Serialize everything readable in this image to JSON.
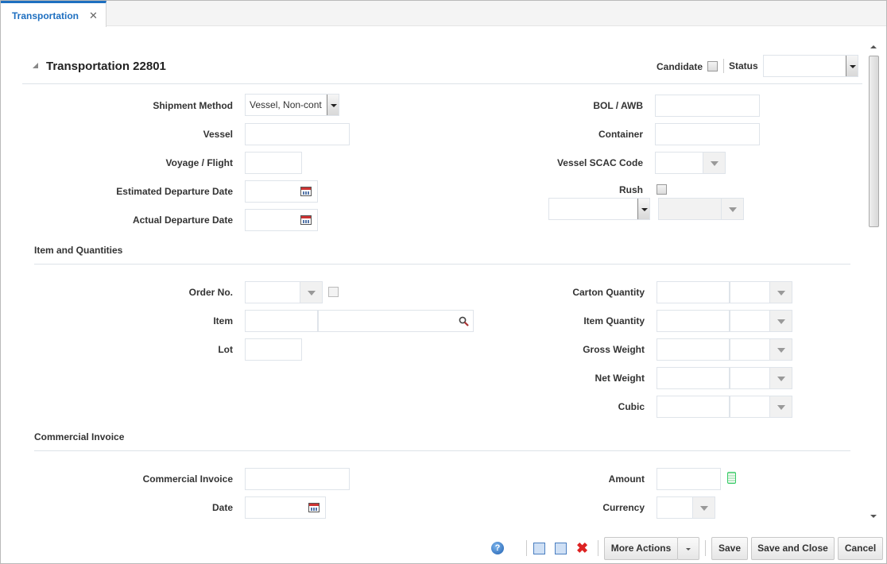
{
  "tab": {
    "label": "Transportation",
    "close": "✕"
  },
  "header": {
    "title": "Transportation 22801",
    "candidate_label": "Candidate",
    "candidate_checked": false,
    "status_label": "Status",
    "status_value": ""
  },
  "shipment": {
    "shipment_method_label": "Shipment Method",
    "shipment_method_value": "Vessel, Non-cont",
    "vessel_label": "Vessel",
    "vessel_value": "",
    "voyage_label": "Voyage / Flight",
    "voyage_value": "",
    "est_departure_label": "Estimated Departure Date",
    "est_departure_value": "",
    "act_departure_label": "Actual Departure Date",
    "act_departure_value": "",
    "bol_label": "BOL / AWB",
    "bol_value": "",
    "container_label": "Container",
    "container_value": "",
    "scac_label": "Vessel SCAC Code",
    "scac_value": "",
    "rush_label": "Rush",
    "rush_checked": false
  },
  "items": {
    "section_title": "Item and Quantities",
    "order_label": "Order No.",
    "item_label": "Item",
    "lot_label": "Lot",
    "carton_label": "Carton Quantity",
    "item_qty_label": "Item Quantity",
    "gross_label": "Gross Weight",
    "net_label": "Net Weight",
    "cubic_label": "Cubic"
  },
  "invoice": {
    "section_title": "Commercial Invoice",
    "invoice_label": "Commercial Invoice",
    "date_label": "Date",
    "amount_label": "Amount",
    "currency_label": "Currency"
  },
  "footer": {
    "more_actions": "More Actions",
    "save": "Save",
    "save_close": "Save and Close",
    "cancel": "Cancel",
    "help": "?"
  }
}
